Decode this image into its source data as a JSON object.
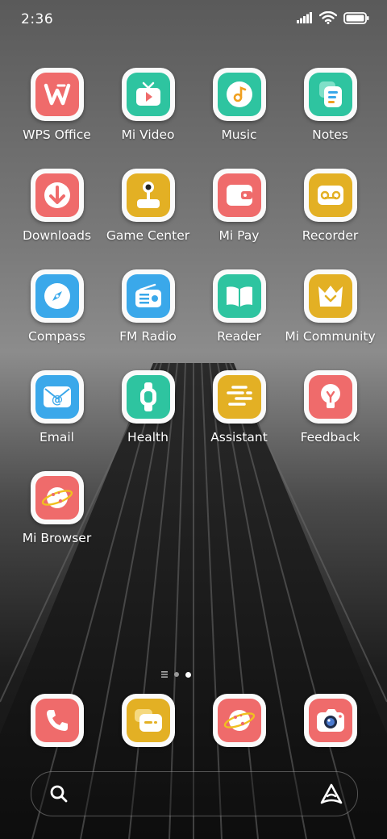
{
  "status_bar": {
    "time": "2:36"
  },
  "apps": [
    {
      "label": "WPS Office",
      "icon": "wps-office-icon",
      "color": "#ef6b6b"
    },
    {
      "label": "Mi Video",
      "icon": "mi-video-icon",
      "color": "#2ec4a0"
    },
    {
      "label": "Music",
      "icon": "music-icon",
      "color": "#2ec4a0"
    },
    {
      "label": "Notes",
      "icon": "notes-icon",
      "color": "#2ec4a0"
    },
    {
      "label": "Downloads",
      "icon": "downloads-icon",
      "color": "#ef6b6b"
    },
    {
      "label": "Game Center",
      "icon": "game-center-icon",
      "color": "#e3b024"
    },
    {
      "label": "Mi Pay",
      "icon": "mi-pay-icon",
      "color": "#ef6b6b"
    },
    {
      "label": "Recorder",
      "icon": "recorder-icon",
      "color": "#e3b024"
    },
    {
      "label": "Compass",
      "icon": "compass-icon",
      "color": "#3aa8ea"
    },
    {
      "label": "FM Radio",
      "icon": "fm-radio-icon",
      "color": "#3aa8ea"
    },
    {
      "label": "Reader",
      "icon": "reader-icon",
      "color": "#2ec4a0"
    },
    {
      "label": "Mi Community",
      "icon": "mi-community-icon",
      "color": "#e3b024"
    },
    {
      "label": "Email",
      "icon": "email-icon",
      "color": "#3aa8ea"
    },
    {
      "label": "Health",
      "icon": "health-icon",
      "color": "#2ec4a0"
    },
    {
      "label": "Assistant",
      "icon": "assistant-icon",
      "color": "#e3b024"
    },
    {
      "label": "Feedback",
      "icon": "feedback-icon",
      "color": "#ef6b6b"
    },
    {
      "label": "Mi Browser",
      "icon": "mi-browser-icon",
      "color": "#ef6b6b"
    }
  ],
  "pagination": {
    "pages": 3,
    "current": 3
  },
  "dock": [
    {
      "icon": "phone-icon",
      "color": "#ef6b6b"
    },
    {
      "icon": "messages-icon",
      "color": "#e3b024"
    },
    {
      "icon": "browser-icon",
      "color": "#ef6b6b"
    },
    {
      "icon": "camera-icon",
      "color": "#ef6b6b"
    }
  ]
}
